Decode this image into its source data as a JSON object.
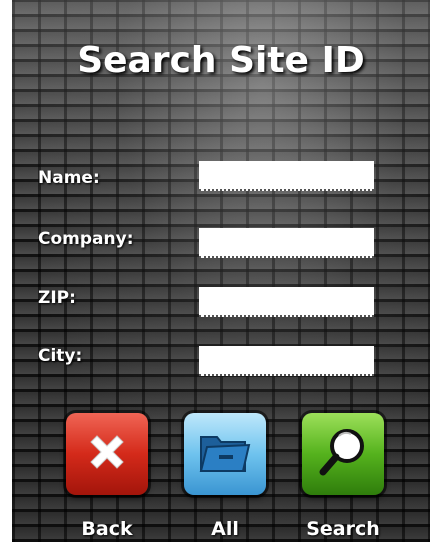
{
  "page": {
    "title": "Search Site ID"
  },
  "form": {
    "name_label": "Name:",
    "company_label": "Company:",
    "zip_label": "ZIP:",
    "city_label": "City:",
    "name_value": "",
    "company_value": "",
    "zip_value": "",
    "city_value": ""
  },
  "buttons": {
    "back_label": "Back",
    "all_label": "All",
    "search_label": "Search",
    "back_icon": "close-x-icon",
    "all_icon": "folder-icon",
    "search_icon": "magnifier-icon"
  },
  "colors": {
    "back_red": "#d42a1a",
    "all_blue": "#6fc3ee",
    "search_green": "#55b21d"
  }
}
